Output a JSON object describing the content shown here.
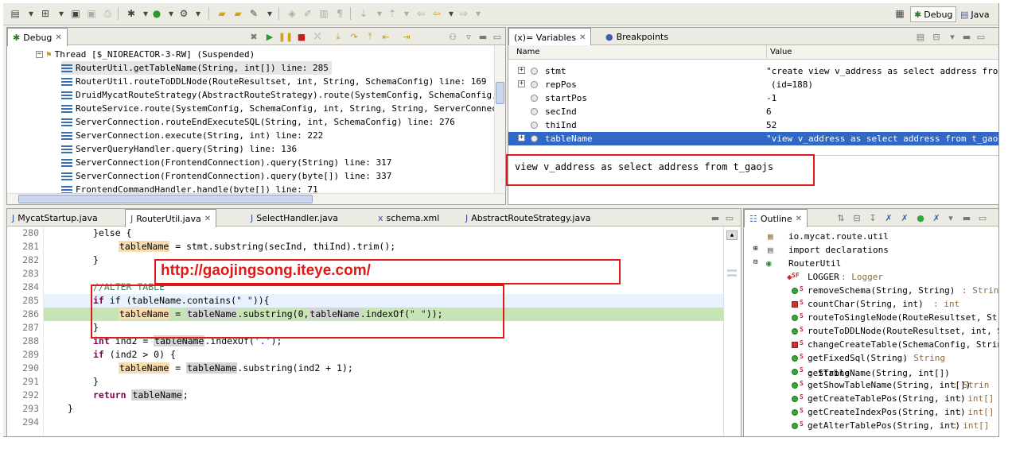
{
  "toolbar": {
    "perspectives": [
      {
        "label": "Debug"
      },
      {
        "label": "Java"
      }
    ]
  },
  "debug": {
    "tab": "Debug",
    "thread": "Thread [$_NIOREACTOR-3-RW] (Suspended)",
    "frames": [
      "RouterUtil.getTableName(String, int[]) line: 285",
      "RouterUtil.routeToDDLNode(RouteResultset, int, String, SchemaConfig) line: 169",
      "DruidMycatRouteStrategy(AbstractRouteStrategy).route(SystemConfig, SchemaConfig, int,",
      "RouteService.route(SystemConfig, SchemaConfig, int, String, String, ServerConnection)",
      "ServerConnection.routeEndExecuteSQL(String, int, SchemaConfig) line: 276",
      "ServerConnection.execute(String, int) line: 222",
      "ServerQueryHandler.query(String) line: 136",
      "ServerConnection(FrontendConnection).query(String) line: 317",
      "ServerConnection(FrontendConnection).query(byte[]) line: 337",
      "FrontendCommandHandler.handle(byte[]) line: 71"
    ]
  },
  "variables": {
    "tabs": [
      "(x)= Variables",
      "Breakpoints"
    ],
    "col_name": "Name",
    "col_value": "Value",
    "rows": [
      {
        "name": "stmt",
        "value": "\"create view v_address as select address from t_g"
      },
      {
        "name": "repPos",
        "value": "(id=188)"
      },
      {
        "name": "startPos",
        "value": "-1"
      },
      {
        "name": "secInd",
        "value": "6"
      },
      {
        "name": "thiInd",
        "value": "52"
      },
      {
        "name": "tableName",
        "value": "\"view v_address as select address from t_gaojs\""
      }
    ],
    "detail": "view v_address as select address from t_gaojs"
  },
  "editor": {
    "tabs": [
      "MycatStartup.java",
      "RouterUtil.java",
      "SelectHandler.java",
      "schema.xml",
      "AbstractRouteStrategy.java"
    ],
    "lines": [
      {
        "n": "280"
      },
      {
        "n": "281"
      },
      {
        "n": "282"
      },
      {
        "n": "283"
      },
      {
        "n": "284"
      },
      {
        "n": "285"
      },
      {
        "n": "286"
      },
      {
        "n": "287"
      },
      {
        "n": "288"
      },
      {
        "n": "289"
      },
      {
        "n": "290"
      },
      {
        "n": "291"
      },
      {
        "n": "292"
      },
      {
        "n": "293"
      },
      {
        "n": "294"
      }
    ],
    "code": {
      "l280a": "}else {",
      "l281v": "tableName",
      "l281r": " = stmt.substring(secInd, thiInd).trim();",
      "l282": "}",
      "l284": "//ALTER TABLE",
      "l285a": "if (tableName.contains(",
      "l285s": "\" \"",
      "l285b": ")){",
      "l286v": "tableName",
      "l286m": " = ",
      "l286v2": "tableName",
      "l286r": ".substring(0,",
      "l286v3": "tableName",
      "l286r2": ".indexOf(",
      "l286s": "\" \"",
      "l286r3": "));",
      "l287": "}",
      "l288k": "int",
      "l288m": " ind2 = ",
      "l288v": "tableName",
      "l288r": ".indexOf(",
      "l288s": "'.'",
      "l288e": ");",
      "l289k": "if",
      "l289r": " (ind2 > 0) {",
      "l290v": "tableName",
      "l290m": " = ",
      "l290v2": "tableName",
      "l290r": ".substring(ind2 + 1);",
      "l291": "}",
      "l292k": "return",
      "l292v": "tableName",
      "l292e": ";",
      "l293": "}"
    }
  },
  "outline": {
    "tab": "Outline",
    "items": [
      {
        "label": "io.mycat.route.util",
        "ret": ""
      },
      {
        "label": "import declarations",
        "ret": ""
      },
      {
        "label": "RouterUtil",
        "ret": ""
      },
      {
        "label": "LOGGER",
        "ret": " : Logger"
      },
      {
        "label": "removeSchema(String, String)",
        "ret": " : String"
      },
      {
        "label": "countChar(String, int)",
        "ret": " : int"
      },
      {
        "label": "routeToSingleNode(RouteResultset, Strin",
        "ret": ""
      },
      {
        "label": "routeToDDLNode(RouteResultset, int, Str",
        "ret": ""
      },
      {
        "label": "changeCreateTable(SchemaConfig, String,",
        "ret": ""
      },
      {
        "label": "getFixedSql(String)",
        "ret": " : String"
      },
      {
        "label": "getTableName(String, int[])",
        "ret": " : String"
      },
      {
        "label": "getShowTableName(String, int[])",
        "ret": " : Strin"
      },
      {
        "label": "getCreateTablePos(String, int)",
        "ret": " : int[]"
      },
      {
        "label": "getCreateIndexPos(String, int)",
        "ret": " : int[]"
      },
      {
        "label": "getAlterTablePos(String, int)",
        "ret": " : int[]"
      }
    ]
  },
  "watermark": "http://gaojingsong.iteye.com/"
}
